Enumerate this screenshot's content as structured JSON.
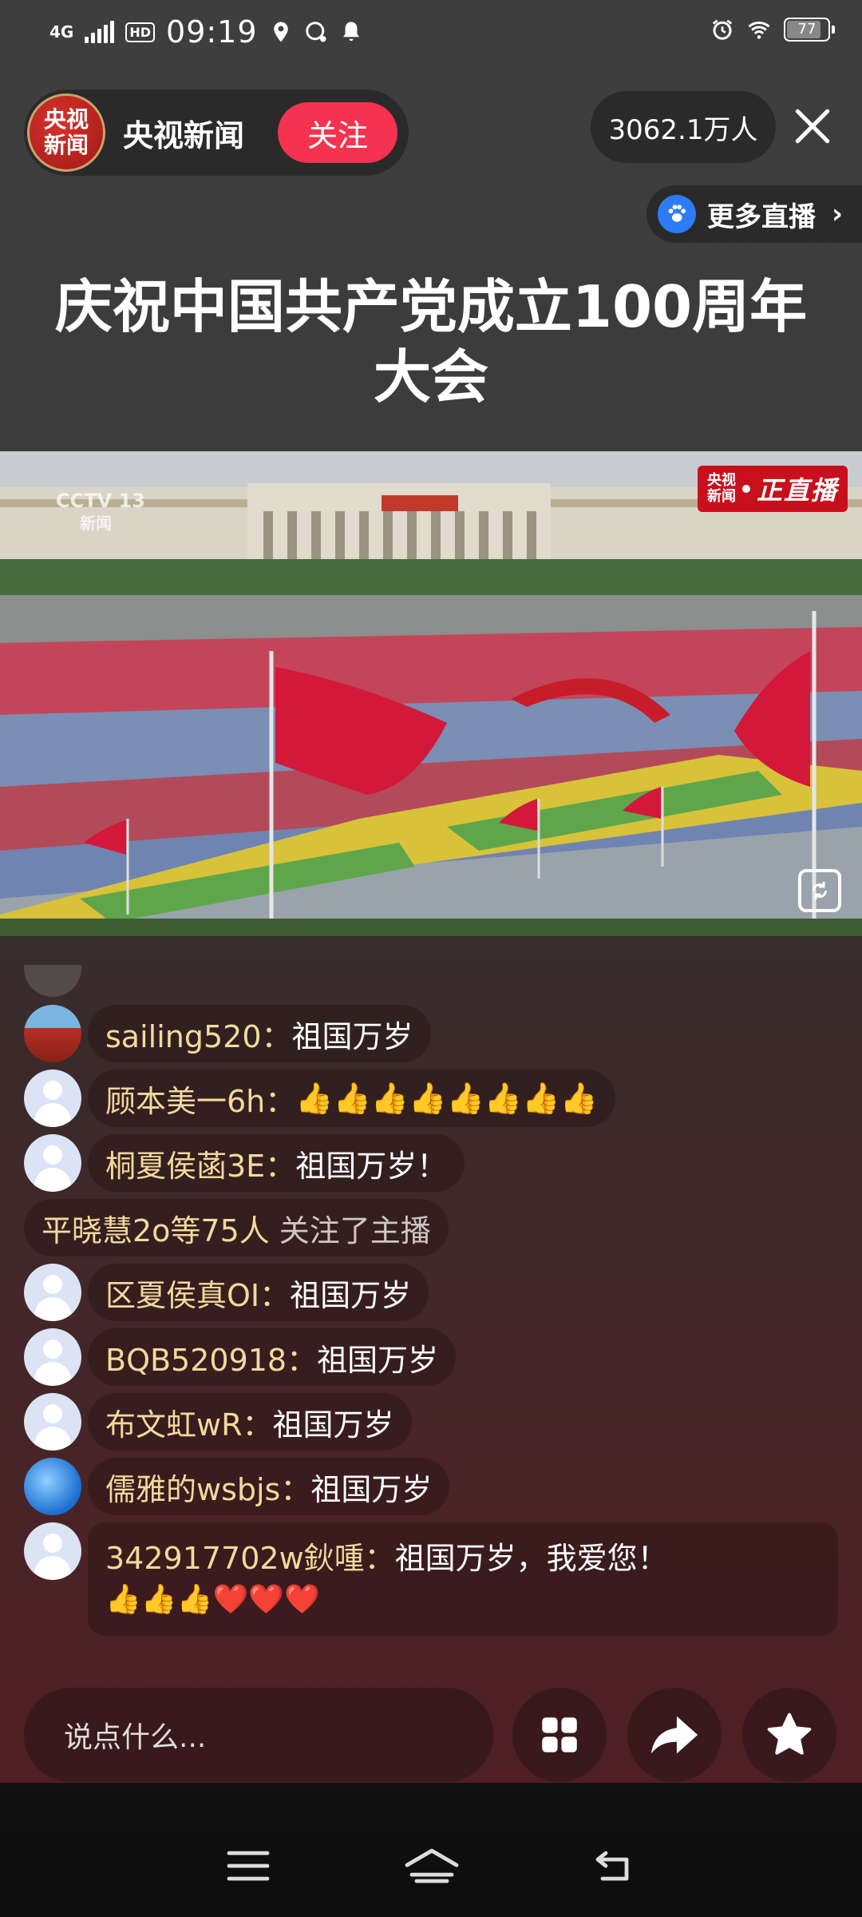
{
  "status_bar": {
    "network": "4G",
    "hd": "HD",
    "time": "09:19",
    "battery": "77"
  },
  "host": {
    "avatar_text": [
      "央视",
      "新闻"
    ],
    "name": "央视新闻",
    "follow_label": "关注"
  },
  "viewers": "3062.1万人",
  "more_live_label": "更多直播",
  "title": "庆祝中国共产党成立100周年大会",
  "video": {
    "watermark": [
      "CCTV 13",
      "新闻"
    ],
    "live_badge_small": [
      "央视",
      "新闻"
    ],
    "live_badge_text": "正直播"
  },
  "comments": [
    {
      "user": "sailing520：",
      "text": "祖国万岁",
      "avatar": "gate"
    },
    {
      "user": "顾本美一6h：",
      "text": "👍👍👍👍👍👍👍👍",
      "avatar": "default"
    },
    {
      "user": "桐夏侯菡3E：",
      "text": "祖国万岁！",
      "avatar": "default"
    },
    {
      "user": "平晓慧2o等75人",
      "text": "关注了主播",
      "type": "notice"
    },
    {
      "user": "区夏侯真OI：",
      "text": "祖国万岁",
      "avatar": "default"
    },
    {
      "user": "BQB520918：",
      "text": "祖国万岁",
      "avatar": "default"
    },
    {
      "user": "布文虹wR：",
      "text": "祖国万岁",
      "avatar": "default"
    },
    {
      "user": "儒雅的wsbjs：",
      "text": "祖国万岁",
      "avatar": "wave"
    },
    {
      "user": "342917702w鈥喠：",
      "text": "祖国万岁，我爱您！",
      "avatar": "default",
      "emojis": "👍👍👍❤️❤️❤️"
    }
  ],
  "input_placeholder": "说点什么...",
  "icons": {
    "grid": "grid-icon",
    "share": "share-icon",
    "star": "star-icon",
    "close": "close-icon",
    "nav_menu": "menu-icon",
    "nav_home": "home-icon",
    "nav_back": "back-icon"
  },
  "colors": {
    "follow": "#f5324f",
    "username": "#f3d99d",
    "live_badge": "#c8101d"
  }
}
